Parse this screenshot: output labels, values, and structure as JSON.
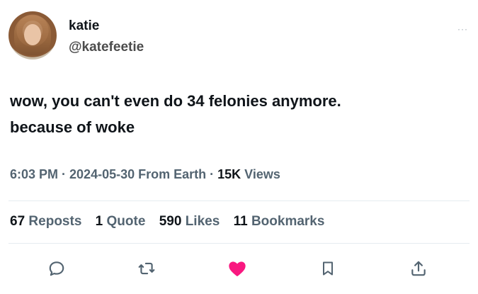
{
  "user": {
    "name": "katie",
    "handle": "@katefeetie"
  },
  "menu_label": "···",
  "tweet": {
    "line1": "wow, you can't even do 34 felonies anymore.",
    "line2": "because of woke"
  },
  "meta": {
    "time": "6:03 PM",
    "separator1": " · ",
    "date": "2024-05-30",
    "source": " From Earth",
    "separator2": " · ",
    "views_count": "15K",
    "views_label": " Views"
  },
  "stats": [
    {
      "count": "67",
      "label": "Reposts"
    },
    {
      "count": "1",
      "label": "Quote"
    },
    {
      "count": "590",
      "label": "Likes"
    },
    {
      "count": "11",
      "label": "Bookmarks"
    }
  ],
  "actions": {
    "reply_icon": "reply-icon",
    "repost_icon": "repost-icon",
    "like_icon": "heart-icon",
    "bookmark_icon": "bookmark-icon",
    "share_icon": "share-icon",
    "like_color": "#f91880",
    "icon_color": "#536471"
  }
}
